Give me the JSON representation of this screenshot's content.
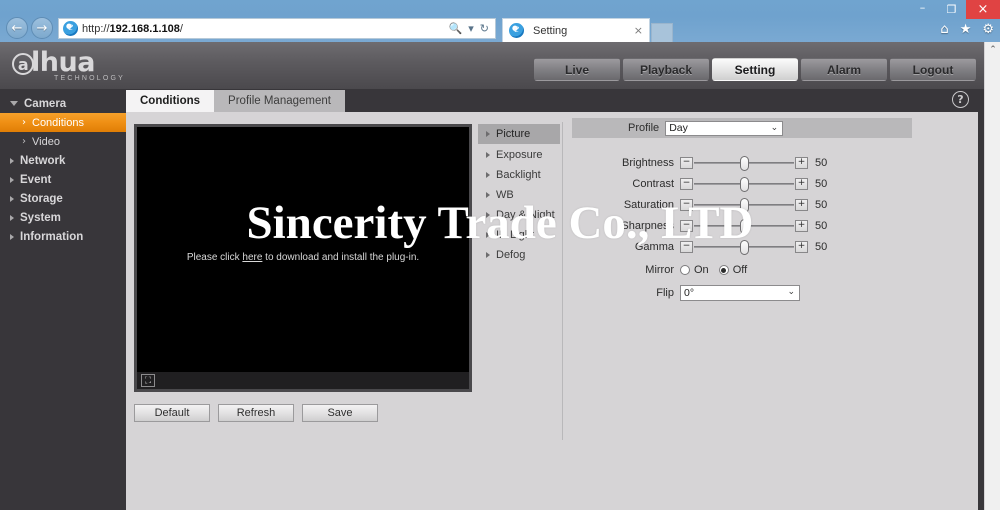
{
  "browser": {
    "url_prefix": "http://",
    "url_host": "192.168.1.108",
    "url_suffix": "/",
    "search_icon": "search-icon",
    "refresh_icon": "refresh-icon",
    "back_icon": "back-arrow-icon",
    "forward_icon": "forward-arrow-icon",
    "tab_title": "Setting",
    "tab_close": "×",
    "minimize": "–",
    "maximize": "❐",
    "close": "×",
    "home_icon": "⌂",
    "favorites_icon": "★",
    "tools_icon": "⚙"
  },
  "header": {
    "logo_at": "a",
    "logo_text": "lhua",
    "logo_sub": "TECHNOLOGY",
    "nav": [
      {
        "label": "Live",
        "active": false
      },
      {
        "label": "Playback",
        "active": false
      },
      {
        "label": "Setting",
        "active": true
      },
      {
        "label": "Alarm",
        "active": false
      },
      {
        "label": "Logout",
        "active": false
      }
    ]
  },
  "sidebar": {
    "items": [
      {
        "label": "Camera",
        "type": "group",
        "expanded": true
      },
      {
        "label": "Conditions",
        "type": "sub",
        "active": true
      },
      {
        "label": "Video",
        "type": "sub",
        "active": false
      },
      {
        "label": "Network",
        "type": "group",
        "expanded": false
      },
      {
        "label": "Event",
        "type": "group",
        "expanded": false
      },
      {
        "label": "Storage",
        "type": "group",
        "expanded": false
      },
      {
        "label": "System",
        "type": "group",
        "expanded": false
      },
      {
        "label": "Information",
        "type": "group",
        "expanded": false
      }
    ]
  },
  "content": {
    "tabs": [
      {
        "label": "Conditions",
        "active": true
      },
      {
        "label": "Profile Management",
        "active": false
      }
    ],
    "help_icon": "?",
    "video": {
      "message_prefix": "Please click ",
      "message_link": "here",
      "message_suffix": " to download and install the plug-in.",
      "fullscreen_icon": "⛶"
    },
    "buttons": [
      {
        "label": "Default"
      },
      {
        "label": "Refresh"
      },
      {
        "label": "Save"
      }
    ],
    "mid_menu": [
      {
        "label": "Picture",
        "active": true
      },
      {
        "label": "Exposure",
        "active": false
      },
      {
        "label": "Backlight",
        "active": false
      },
      {
        "label": "WB",
        "active": false
      },
      {
        "label": "Day & Night",
        "active": false
      },
      {
        "label": "IR Light",
        "active": false
      },
      {
        "label": "Defog",
        "active": false
      }
    ],
    "form": {
      "profile_label": "Profile",
      "profile_value": "Day",
      "dropdown_arrow": "⌄",
      "minus": "−",
      "plus": "+",
      "sliders": [
        {
          "label": "Brightness",
          "value": "50"
        },
        {
          "label": "Contrast",
          "value": "50"
        },
        {
          "label": "Saturation",
          "value": "50"
        },
        {
          "label": "Sharpness",
          "value": "50"
        },
        {
          "label": "Gamma",
          "value": "50"
        }
      ],
      "mirror_label": "Mirror",
      "mirror_on": "On",
      "mirror_off": "Off",
      "mirror_selected": "Off",
      "flip_label": "Flip",
      "flip_value": "0°"
    }
  },
  "scrollbar": {
    "up_arrow": "⌃",
    "down_arrow": "⌄"
  },
  "watermark": {
    "text": "Sincerity Trade Co., LTD"
  }
}
